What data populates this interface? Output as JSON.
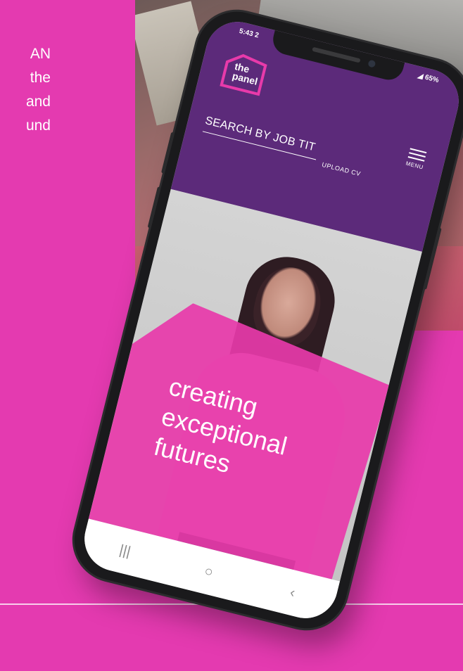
{
  "left_text": {
    "lines": [
      "AN",
      "the",
      "and",
      "und"
    ]
  },
  "phone": {
    "status_left": "5:43 2",
    "status_right": "◢ 65%",
    "logo_text_line1": "the",
    "logo_text_line2": "panel",
    "search_text": "SEARCH BY JOB TIT",
    "upload_text": "UPLOAD CV",
    "menu_label": "MENU",
    "tagline": [
      "creating",
      "exceptional",
      "futures"
    ],
    "nav_icons": [
      "recents-icon",
      "home-icon",
      "back-icon"
    ]
  },
  "colors": {
    "background": "#e43ab0",
    "header": "#5c2a7a",
    "brand_pink": "#e83aaa"
  }
}
